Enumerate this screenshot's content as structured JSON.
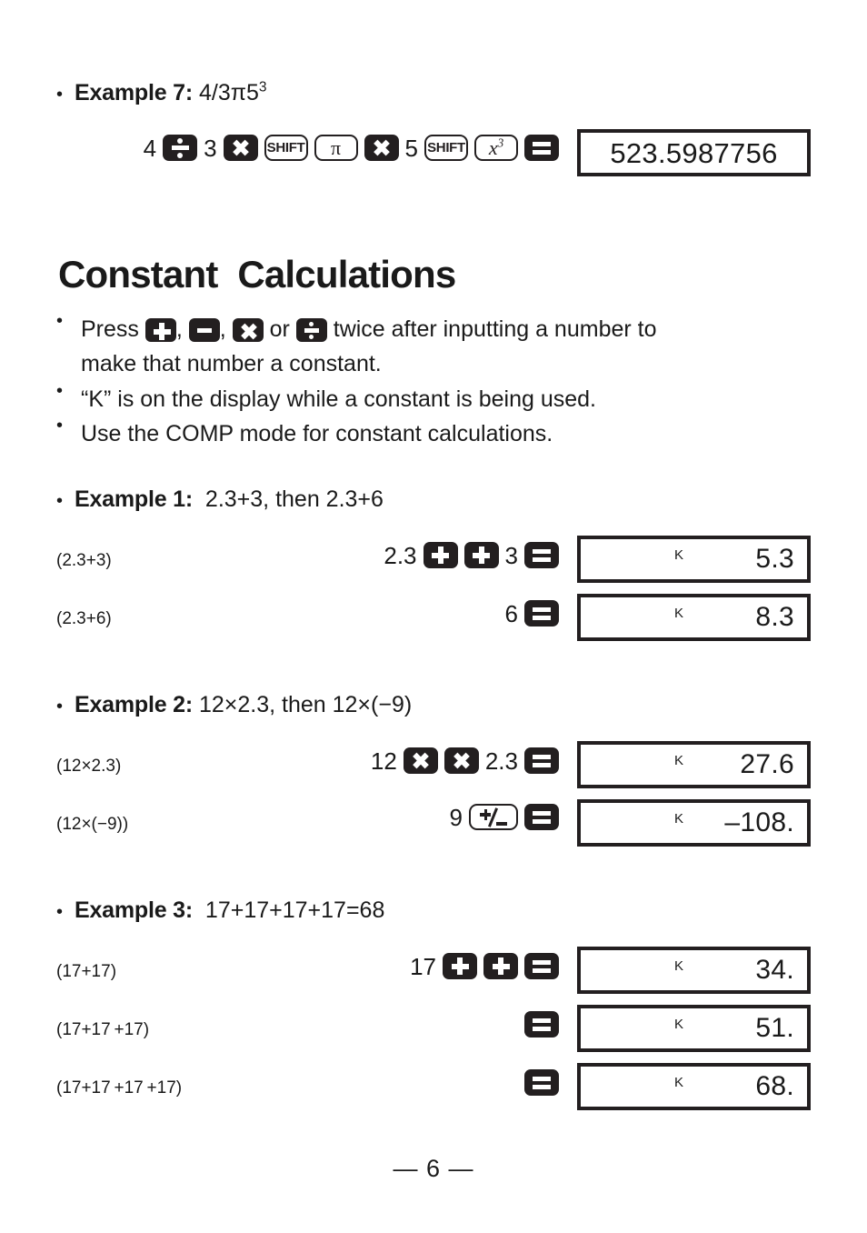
{
  "page": {
    "footer": "— 6 —"
  },
  "example7": {
    "label": "Example 7:",
    "formula_main": "4/3π5",
    "formula_sup": "3",
    "keys": [
      {
        "type": "num",
        "text": "4"
      },
      {
        "type": "dark",
        "glyph": "divide"
      },
      {
        "type": "num",
        "text": "3"
      },
      {
        "type": "dark",
        "glyph": "times"
      },
      {
        "type": "light",
        "text": "SHIFT"
      },
      {
        "type": "light",
        "text": "π"
      },
      {
        "type": "dark",
        "glyph": "times"
      },
      {
        "type": "num",
        "text": "5"
      },
      {
        "type": "light",
        "text": "SHIFT"
      },
      {
        "type": "light",
        "text": "x3"
      },
      {
        "type": "dark",
        "glyph": "equals"
      }
    ],
    "result": "523.5987756"
  },
  "section": {
    "title": "Constant  Calculations",
    "notes": [
      {
        "segments": [
          {
            "kind": "text",
            "text": "Press "
          },
          {
            "kind": "key",
            "glyph": "plus"
          },
          {
            "kind": "text",
            "text": ", "
          },
          {
            "kind": "key",
            "glyph": "minus"
          },
          {
            "kind": "text",
            "text": ", "
          },
          {
            "kind": "key",
            "glyph": "times"
          },
          {
            "kind": "text",
            "text": " or "
          },
          {
            "kind": "key",
            "glyph": "divide"
          },
          {
            "kind": "text",
            "text": " twice after inputting a number to"
          }
        ],
        "line2": "make that number a constant."
      },
      {
        "plain": "“K” is on the display while a constant is being used."
      },
      {
        "plain": "Use the COMP mode for constant calculations."
      }
    ]
  },
  "example1": {
    "label": "Example 1:",
    "formula": "2.3+3, then 2.3+6",
    "rows": [
      {
        "label": "(2.3+3)",
        "keys": [
          {
            "type": "num",
            "text": "2.3"
          },
          {
            "type": "dark",
            "glyph": "plus"
          },
          {
            "type": "dark",
            "glyph": "plus"
          },
          {
            "type": "num",
            "text": "3"
          },
          {
            "type": "dark",
            "glyph": "equals"
          }
        ],
        "flag": "K",
        "result": "5.3"
      },
      {
        "label": "(2.3+6)",
        "keys": [
          {
            "type": "num",
            "text": "6"
          },
          {
            "type": "dark",
            "glyph": "equals"
          }
        ],
        "flag": "K",
        "result": "8.3"
      }
    ]
  },
  "example2": {
    "label": "Example 2:",
    "formula": "12×2.3, then 12×(−9)",
    "rows": [
      {
        "label": "(12×2.3)",
        "keys": [
          {
            "type": "num",
            "text": "12"
          },
          {
            "type": "dark",
            "glyph": "times"
          },
          {
            "type": "dark",
            "glyph": "times"
          },
          {
            "type": "num",
            "text": "2.3"
          },
          {
            "type": "dark",
            "glyph": "equals"
          }
        ],
        "flag": "K",
        "result": "27.6"
      },
      {
        "label": "(12×(−9))",
        "keys": [
          {
            "type": "num",
            "text": "9"
          },
          {
            "type": "light",
            "text": "+/-"
          },
          {
            "type": "dark",
            "glyph": "equals"
          }
        ],
        "flag": "K",
        "result": "–108."
      }
    ]
  },
  "example3": {
    "label": "Example 3:",
    "formula": "17+17+17+17=68",
    "rows": [
      {
        "label": "(17+17)",
        "keys": [
          {
            "type": "num",
            "text": "17"
          },
          {
            "type": "dark",
            "glyph": "plus"
          },
          {
            "type": "dark",
            "glyph": "plus"
          },
          {
            "type": "dark",
            "glyph": "equals"
          }
        ],
        "flag": "K",
        "result": "34."
      },
      {
        "label": "(17+17 +17)",
        "keys": [
          {
            "type": "dark",
            "glyph": "equals"
          }
        ],
        "flag": "K",
        "result": "51."
      },
      {
        "label": "(17+17 +17 +17)",
        "keys": [
          {
            "type": "dark",
            "glyph": "equals"
          }
        ],
        "flag": "K",
        "result": "68."
      }
    ]
  }
}
